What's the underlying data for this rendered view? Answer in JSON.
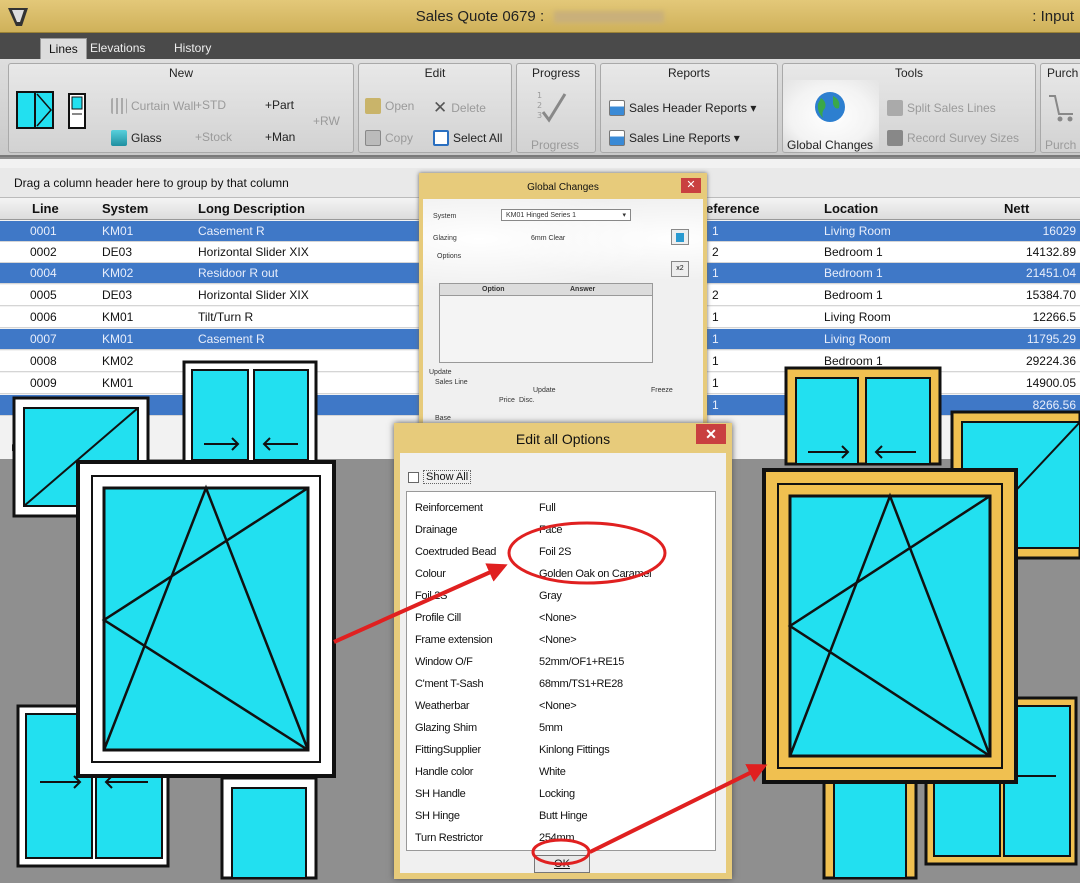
{
  "window": {
    "title": "Sales Quote 0679",
    "title_prefix": ":",
    "mode": ": Input"
  },
  "tabs": [
    {
      "label": "Lines"
    },
    {
      "label": "Elevations"
    },
    {
      "label": "History"
    }
  ],
  "ribbon": {
    "new": {
      "title": "New",
      "curtain_wall": "Curtain Wall",
      "std": "+STD",
      "part": "+Part",
      "rw": "+RW",
      "glass": "Glass",
      "stock": "+Stock",
      "man": "+Man"
    },
    "edit": {
      "title": "Edit",
      "open": "Open",
      "delete": "Delete",
      "copy": "Copy",
      "select_all": "Select All"
    },
    "progress": {
      "title": "Progress",
      "button": "Progress"
    },
    "reports": {
      "title": "Reports",
      "header": "Sales Header Reports ▾",
      "line": "Sales Line Reports ▾"
    },
    "tools": {
      "title": "Tools",
      "global": "Global Changes",
      "split": "Split Sales Lines",
      "survey": "Record Survey Sizes"
    },
    "purchase": {
      "title": "Purch",
      "button": "Purch"
    }
  },
  "grid": {
    "group_hint": "Drag a column header here to group by that column",
    "columns": {
      "line": "Line",
      "system": "System",
      "desc": "Long Description",
      "reference": "eference",
      "location": "Location",
      "nett": "Nett"
    },
    "rows": [
      {
        "line": "0001",
        "system": "KM01",
        "desc": "Casement R",
        "ref": "1",
        "location": "Living Room",
        "nett": "16029",
        "sel": true
      },
      {
        "line": "0002",
        "system": "DE03",
        "desc": "Horizontal Slider XIX",
        "ref": "2",
        "location": "Bedroom 1",
        "nett": "14132.89",
        "sel": false
      },
      {
        "line": "0004",
        "system": "KM02",
        "desc": "Residoor R out",
        "ref": "1",
        "location": "Bedroom 1",
        "nett": "21451.04",
        "sel": true
      },
      {
        "line": "0005",
        "system": "DE03",
        "desc": "Horizontal Slider XIX",
        "ref": "2",
        "location": "Bedroom 1",
        "nett": "15384.70",
        "sel": false
      },
      {
        "line": "0006",
        "system": "KM01",
        "desc": "Tilt/Turn R",
        "ref": "1",
        "location": "Living Room",
        "nett": "12266.5",
        "sel": false
      },
      {
        "line": "0007",
        "system": "KM01",
        "desc": "Casement R",
        "ref": "1",
        "location": "Living Room",
        "nett": "11795.29",
        "sel": true
      },
      {
        "line": "0008",
        "system": "KM02",
        "desc": "",
        "ref": "1",
        "location": "Bedroom 1",
        "nett": "29224.36",
        "sel": false
      },
      {
        "line": "0009",
        "system": "KM01",
        "desc": "",
        "ref": "1",
        "location": "",
        "nett": "14900.05",
        "sel": false
      },
      {
        "line": "",
        "system": "",
        "desc": "",
        "ref": "1",
        "location": "",
        "nett": "8266.56",
        "sel": true
      }
    ]
  },
  "global_changes": {
    "title": "Global Changes",
    "system_label": "System",
    "system_value": "KM01 Hinged Series 1",
    "glazing_label": "Glazing",
    "glazing_value": "6mm Clear",
    "options_label": "Options",
    "col_option": "Option",
    "col_answer": "Answer",
    "update_label": "Update",
    "sales_line": "Sales Line",
    "update_col": "Update",
    "freeze_col": "Freeze",
    "price": "Price",
    "disc": "Disc.",
    "base": "Base",
    "btn_x2": "x2"
  },
  "edit_options": {
    "title": "Edit all Options",
    "show_all": "Show All",
    "ok": "OK",
    "options": [
      {
        "name": "Reinforcement",
        "value": "Full"
      },
      {
        "name": "Drainage",
        "value": "Face"
      },
      {
        "name": "Coextruded Bead",
        "value": "Foil 2S"
      },
      {
        "name": "Colour",
        "value": "Golden Oak on Caramel"
      },
      {
        "name": "Foil 2S",
        "value": "Gray"
      },
      {
        "name": "Profile Cill",
        "value": "<None>"
      },
      {
        "name": "Frame extension",
        "value": "<None>"
      },
      {
        "name": "Window O/F",
        "value": "52mm/OF1+RE15"
      },
      {
        "name": "C'ment T-Sash",
        "value": "68mm/TS1+RE28"
      },
      {
        "name": "Weatherbar",
        "value": "<None>"
      },
      {
        "name": "Glazing Shim",
        "value": "5mm"
      },
      {
        "name": "FittingSupplier",
        "value": "Kinlong Fittings"
      },
      {
        "name": "Handle color",
        "value": "White"
      },
      {
        "name": "SH Handle",
        "value": "Locking"
      },
      {
        "name": "SH Hinge",
        "value": "Butt Hinge"
      },
      {
        "name": "Turn Restrictor",
        "value": "254mm"
      }
    ]
  },
  "colors": {
    "glass": "#22e0f0",
    "frame_white": "#ffffff",
    "frame_oak": "#f0c050",
    "annotation": "#e02020",
    "selection": "#3f78c7"
  }
}
